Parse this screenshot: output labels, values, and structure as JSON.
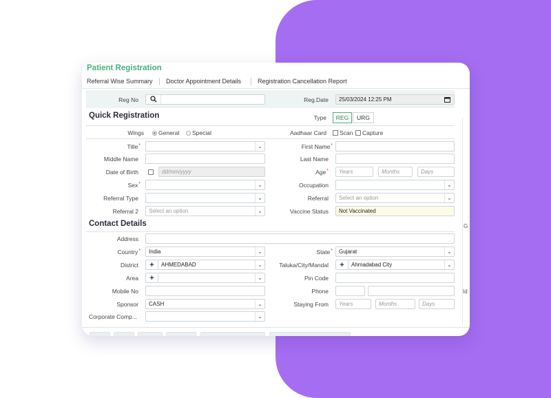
{
  "page": {
    "title": "Patient Registration"
  },
  "tabs": [
    "Referral Wise Summary",
    "Doctor Appointment Details",
    "Registration Cancellation Report"
  ],
  "regbar": {
    "reg_no_label": "Reg No",
    "reg_date_label": "Reg.Date",
    "reg_date_value": "25/03/2024 12:25 PM"
  },
  "quick": {
    "section_title": "Quick Registration",
    "type_label": "Type",
    "type_options": [
      "REG",
      "URG"
    ],
    "wings_label": "Wings",
    "wings_options": [
      "General",
      "Special"
    ],
    "aadhaar_label": "Aadhaar Card",
    "aadhaar_options": [
      "Scan",
      "Capture"
    ],
    "title_label": "Title",
    "first_name_label": "First Name",
    "middle_name_label": "Middle Name",
    "last_name_label": "Last Name",
    "dob_label": "Date of Birth",
    "dob_placeholder": "dd/mm/yyyy",
    "age_label": "Age",
    "age_placeholders": [
      "Years",
      "Months",
      "Days"
    ],
    "sex_label": "Sex",
    "occupation_label": "Occupation",
    "referral_type_label": "Referral Type",
    "referral_label": "Referral",
    "referral_placeholder": "Select an option",
    "referral2_label": "Referral 2",
    "referral2_placeholder": "Select an option",
    "vaccine_label": "Vaccine Status",
    "vaccine_value": "Not Vaccinated"
  },
  "contact": {
    "section_title": "Contact Details",
    "address_label": "Address",
    "country_label": "Country",
    "country_value": "India",
    "state_label": "State",
    "state_value": "Gujarat",
    "district_label": "District",
    "district_value": "AHMEDABAD",
    "taluka_label": "Taluka/City/Mandal",
    "taluka_value": "Ahmadabad City",
    "area_label": "Area",
    "pincode_label": "Pin Code",
    "mobile_label": "Mobile No",
    "phone_label": "Phone",
    "sponsor_label": "Sponsor",
    "sponsor_value": "CASH",
    "staying_label": "Staying From",
    "staying_placeholders": [
      "Years",
      "Months",
      "Days"
    ],
    "corporate_label": "Corporate Comp..."
  },
  "side": {
    "letter_g": "G",
    "letter_id": "Id"
  },
  "colors": {
    "accent": "#4caf7d",
    "background_shape": "#a56df2",
    "required": "#e53935"
  }
}
